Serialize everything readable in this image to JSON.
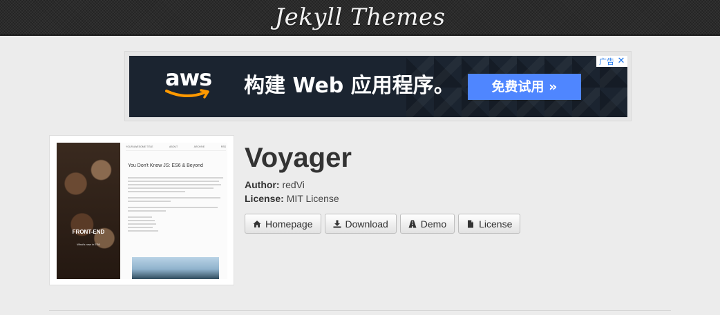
{
  "header": {
    "site_title": "Jekyll Themes"
  },
  "ad": {
    "brand": "aws",
    "headline": "构建 Web 应用程序。",
    "cta_label": "免费试用 »",
    "choices_label": "广告",
    "close_label": "✕",
    "colors": {
      "background": "#1b2430",
      "cta": "#4f86ff",
      "smile": "#ff9900"
    }
  },
  "theme": {
    "name": "Voyager",
    "author_label": "Author:",
    "author": "redVi",
    "license_label": "License:",
    "license": "MIT License",
    "thumbnail": {
      "hero_title": "FRONT-END",
      "hero_subtitle": "What's new in ES6",
      "nav_brand": "YOUR AWESOME TITLE",
      "nav_items": [
        "ABOUT",
        "ARCHIVE",
        "RSS"
      ],
      "post_title": "You Don't Know JS: ES6 & Beyond"
    },
    "buttons": [
      {
        "label": "Homepage",
        "icon": "home-icon"
      },
      {
        "label": "Download",
        "icon": "download-icon"
      },
      {
        "label": "Demo",
        "icon": "road-icon"
      },
      {
        "label": "License",
        "icon": "file-icon"
      }
    ]
  }
}
